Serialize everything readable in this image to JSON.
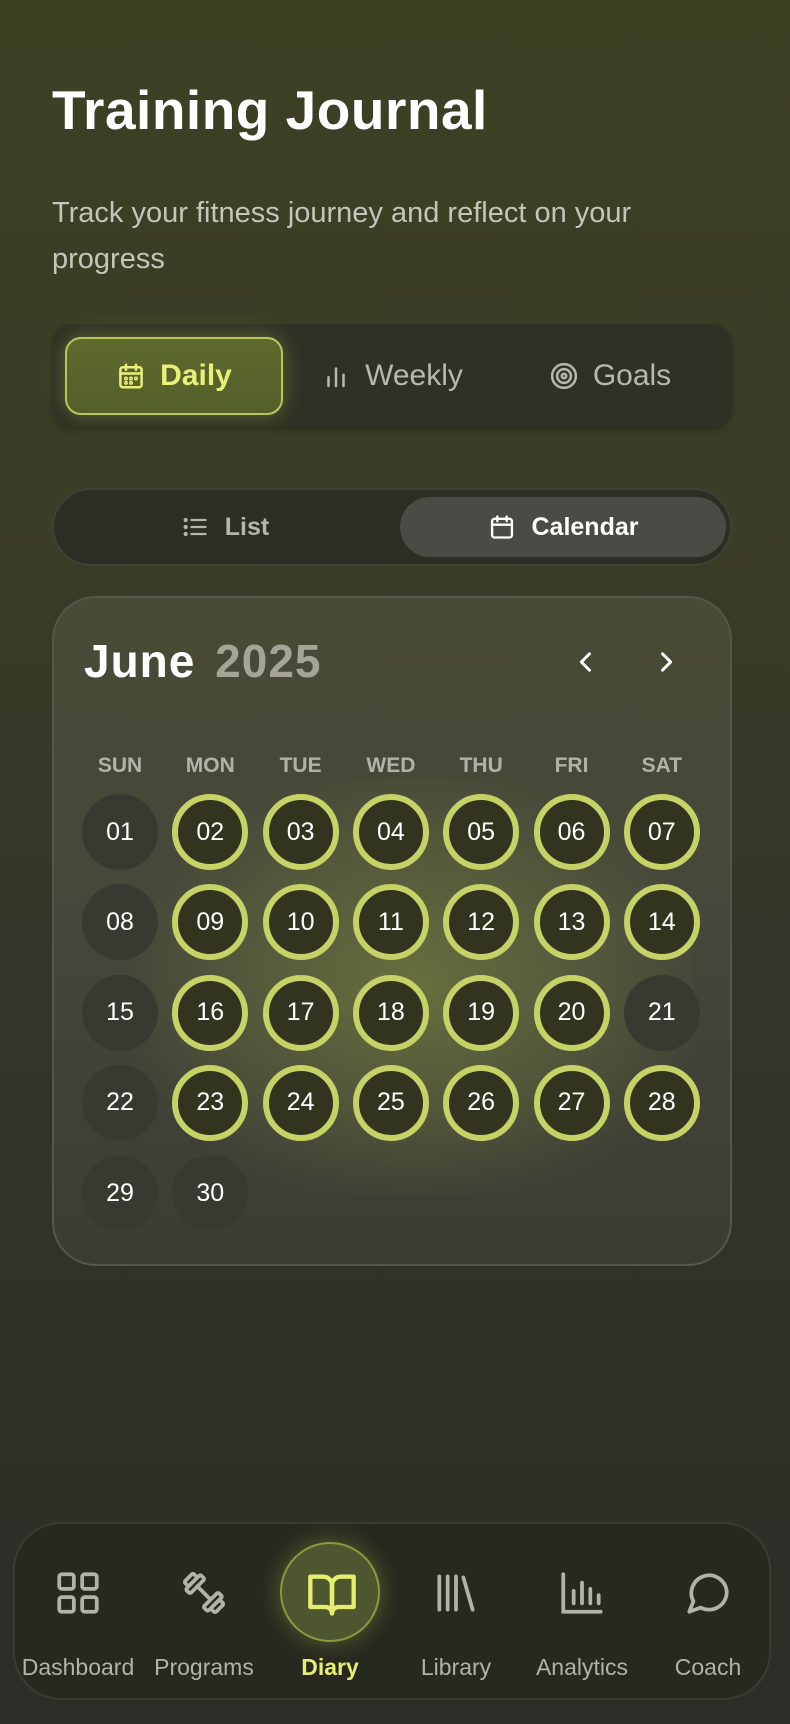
{
  "header": {
    "title": "Training Journal",
    "subtitle": "Track your fitness journey and reflect on your progress"
  },
  "tabs": [
    {
      "label": "Daily",
      "icon": "calendar-icon",
      "active": true
    },
    {
      "label": "Weekly",
      "icon": "bar-chart-icon",
      "active": false
    },
    {
      "label": "Goals",
      "icon": "target-icon",
      "active": false
    }
  ],
  "view_toggle": {
    "list_label": "List",
    "calendar_label": "Calendar",
    "active": "Calendar"
  },
  "calendar": {
    "month": "June",
    "year": "2025",
    "weekdays": [
      "SUN",
      "MON",
      "TUE",
      "WED",
      "THU",
      "FRI",
      "SAT"
    ],
    "days": [
      {
        "label": "01",
        "done": false
      },
      {
        "label": "02",
        "done": true
      },
      {
        "label": "03",
        "done": true
      },
      {
        "label": "04",
        "done": true
      },
      {
        "label": "05",
        "done": true
      },
      {
        "label": "06",
        "done": true
      },
      {
        "label": "07",
        "done": true
      },
      {
        "label": "08",
        "done": false
      },
      {
        "label": "09",
        "done": true
      },
      {
        "label": "10",
        "done": true
      },
      {
        "label": "11",
        "done": true
      },
      {
        "label": "12",
        "done": true
      },
      {
        "label": "13",
        "done": true
      },
      {
        "label": "14",
        "done": true
      },
      {
        "label": "15",
        "done": false
      },
      {
        "label": "16",
        "done": true
      },
      {
        "label": "17",
        "done": true
      },
      {
        "label": "18",
        "done": true
      },
      {
        "label": "19",
        "done": true
      },
      {
        "label": "20",
        "done": true
      },
      {
        "label": "21",
        "done": false
      },
      {
        "label": "22",
        "done": false
      },
      {
        "label": "23",
        "done": true
      },
      {
        "label": "24",
        "done": true
      },
      {
        "label": "25",
        "done": true
      },
      {
        "label": "26",
        "done": true
      },
      {
        "label": "27",
        "done": true
      },
      {
        "label": "28",
        "done": true
      },
      {
        "label": "29",
        "done": false
      },
      {
        "label": "30",
        "done": false
      }
    ]
  },
  "bottom_nav": [
    {
      "label": "Dashboard",
      "icon": "grid-icon",
      "active": false
    },
    {
      "label": "Programs",
      "icon": "dumbbell-icon",
      "active": false
    },
    {
      "label": "Diary",
      "icon": "book-icon",
      "active": true
    },
    {
      "label": "Library",
      "icon": "library-icon",
      "active": false
    },
    {
      "label": "Analytics",
      "icon": "analytics-icon",
      "active": false
    },
    {
      "label": "Coach",
      "icon": "chat-icon",
      "active": false
    }
  ],
  "colors": {
    "accent": "#c5d265",
    "accent_text": "#e8f07a",
    "background": "#3a3d27"
  }
}
